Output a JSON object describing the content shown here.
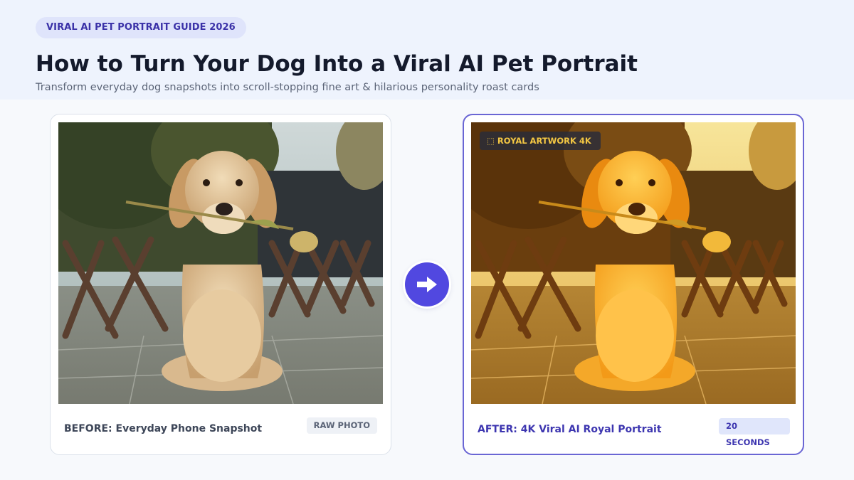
{
  "header": {
    "pill": "VIRAL AI PET PORTRAIT GUIDE 2026",
    "title": "How to Turn Your Dog Into a Viral AI Pet Portrait",
    "subtitle": "Transform everyday dog snapshots into scroll-stopping fine art & hilarious personality roast cards"
  },
  "before": {
    "caption": "BEFORE: Everyday Phone Snapshot",
    "tag": "RAW PHOTO"
  },
  "after": {
    "badge_icon": "crown-icon",
    "badge": "⬚ ROYAL ARTWORK 4K",
    "caption": "AFTER: 4K Viral AI Royal Portrait",
    "tag": "20 SECONDS"
  },
  "transition": {
    "icon": "arrow-right-icon"
  },
  "colors": {
    "accent": "#5148e0",
    "accent_border": "#6a66d4",
    "badge_text": "#f5c843",
    "title": "#141a2c"
  }
}
